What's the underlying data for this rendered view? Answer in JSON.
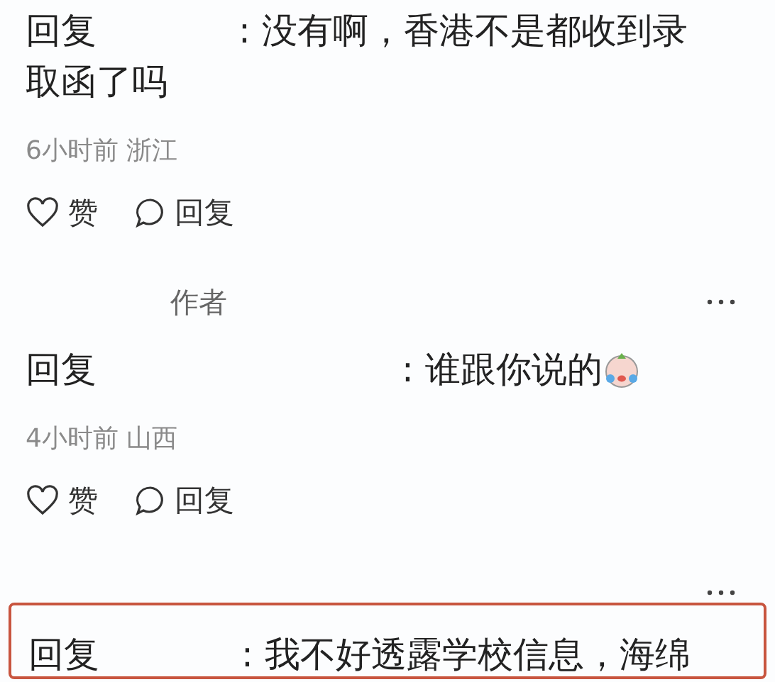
{
  "items": [
    {
      "kind": "comment",
      "prefix": "回复",
      "text": ": 没有啊，香港不是都收到录取函了吗",
      "emoji": false,
      "time": "6小时前",
      "location": "浙江",
      "like_label": "赞",
      "reply_label": "回复",
      "highlighted": false
    },
    {
      "kind": "author_row",
      "tag": "作者"
    },
    {
      "kind": "comment",
      "prefix": "回复",
      "text": ": 谁跟你说的",
      "emoji": true,
      "time": "4小时前",
      "location": "山西",
      "like_label": "赞",
      "reply_label": "回复",
      "highlighted": false
    },
    {
      "kind": "more_row"
    },
    {
      "kind": "comment",
      "prefix": "回复",
      "text": ": 我不好透露学校信息，海绵",
      "emoji": false,
      "highlighted": true
    }
  ]
}
